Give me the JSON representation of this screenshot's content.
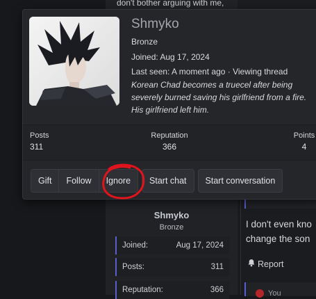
{
  "background": {
    "top_text": "don't bother arguing with me,",
    "username": "Shmyko",
    "rank": "Bronze",
    "stats": [
      {
        "label": "Joined:",
        "value": "Aug 17, 2024"
      },
      {
        "label": "Posts:",
        "value": "311"
      },
      {
        "label": "Reputation:",
        "value": "366"
      }
    ],
    "post_line1": "I don't even kno",
    "post_line2": "change the son",
    "report_label": "Report",
    "quote_author": "You"
  },
  "card": {
    "username": "Shmyko",
    "rank": "Bronze",
    "joined": "Joined: Aug 17, 2024",
    "last_seen": "Last seen: A moment ago · Viewing thread",
    "status": "Korean Chad becomes a truecel after being severely burned saving his girlfriend from a fire. His girlfriend left him.",
    "stats": {
      "posts_label": "Posts",
      "posts_value": "311",
      "rep_label": "Reputation",
      "rep_value": "366",
      "points_label": "Points",
      "points_value": "4"
    },
    "buttons": {
      "gift": "Gift",
      "follow": "Follow",
      "ignore": "Ignore",
      "start_chat": "Start chat",
      "start_conversation": "Start conversation"
    }
  },
  "colors": {
    "accent_border": "#5a5fd0",
    "annotation": "#e0141c",
    "card_bg": "#25262a"
  },
  "icons": [
    "bell-icon"
  ]
}
